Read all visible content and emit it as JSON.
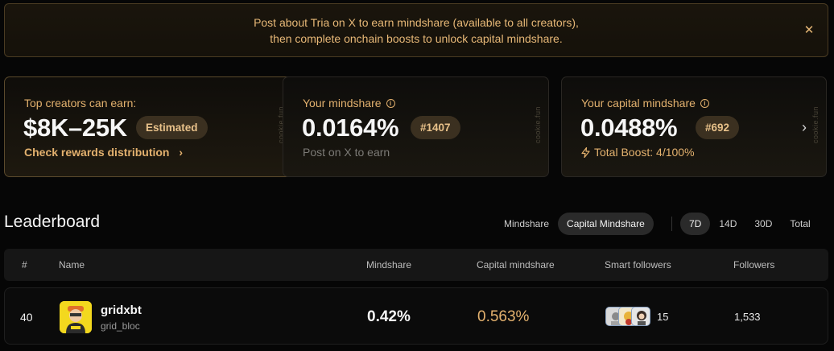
{
  "banner": {
    "line1": "Post about Tria on X to earn mindshare (available to all creators),",
    "line2": "then complete onchain boosts to unlock capital mindshare."
  },
  "cards": {
    "earn": {
      "label": "Top creators can earn:",
      "value": "$8K–25K",
      "pill": "Estimated",
      "link": "Check rewards distribution",
      "watermark": "cookie.fun"
    },
    "mindshare": {
      "label": "Your mindshare",
      "value": "0.0164%",
      "rank": "#1407",
      "sub": "Post on X to earn",
      "watermark": "cookie.fun"
    },
    "capital": {
      "label": "Your capital mindshare",
      "value": "0.0488%",
      "rank": "#692",
      "boost": "Total Boost: 4/100%",
      "watermark": "cookie.fun"
    }
  },
  "leaderboard": {
    "title": "Leaderboard",
    "metric_tabs": [
      "Mindshare",
      "Capital Mindshare"
    ],
    "active_metric": "Capital Mindshare",
    "period_tabs": [
      "7D",
      "14D",
      "30D",
      "Total"
    ],
    "active_period": "7D",
    "columns": [
      "#",
      "Name",
      "Mindshare",
      "Capital mindshare",
      "Smart followers",
      "Followers"
    ],
    "rows": [
      {
        "rank": "40",
        "name": "gridxbt",
        "handle": "grid_bloc",
        "mindshare": "0.42%",
        "capital_mindshare": "0.563%",
        "smart_followers": "15",
        "followers": "1,533"
      }
    ]
  },
  "colors": {
    "accent": "#e3b16e",
    "pill_bg": "#3b3020",
    "background": "#060606"
  }
}
